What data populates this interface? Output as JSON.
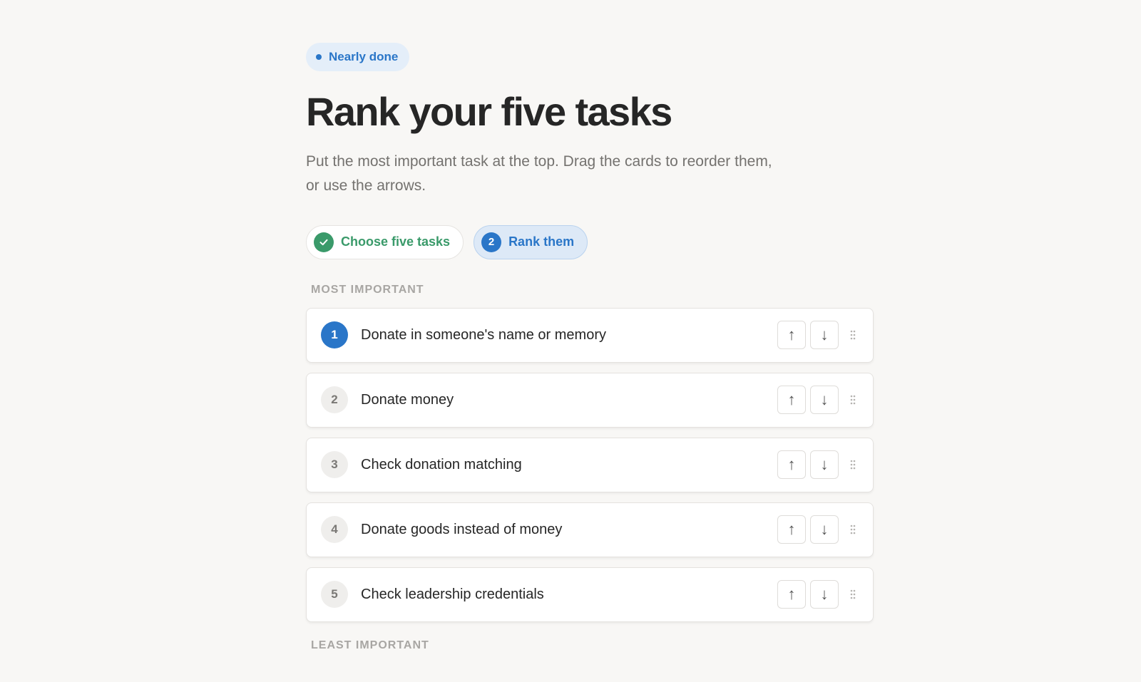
{
  "status": {
    "label": "Nearly done"
  },
  "page": {
    "title": "Rank your five tasks",
    "subtitle_line1": "Put the most important task at the top. Drag the cards to reorder them,",
    "subtitle_line2": "or use the arrows."
  },
  "steps": [
    {
      "label": "Choose five tasks",
      "state": "done",
      "badge_icon": "check-icon"
    },
    {
      "label": "Rank them",
      "state": "current",
      "badge": "2"
    }
  ],
  "labels": {
    "top": "MOST IMPORTANT",
    "bottom": "LEAST IMPORTANT"
  },
  "tasks": [
    {
      "rank": "1",
      "label": "Donate in someone's name or memory"
    },
    {
      "rank": "2",
      "label": "Donate money"
    },
    {
      "rank": "3",
      "label": "Check donation matching"
    },
    {
      "rank": "4",
      "label": "Donate goods instead of money"
    },
    {
      "rank": "5",
      "label": "Check leadership credentials"
    }
  ],
  "controls": {
    "up_glyph": "↑",
    "down_glyph": "↓",
    "drag_icon": "drag-handle-icon"
  },
  "colors": {
    "accent": "#2a76c8",
    "success": "#3a9a6a",
    "background": "#f8f7f5"
  }
}
